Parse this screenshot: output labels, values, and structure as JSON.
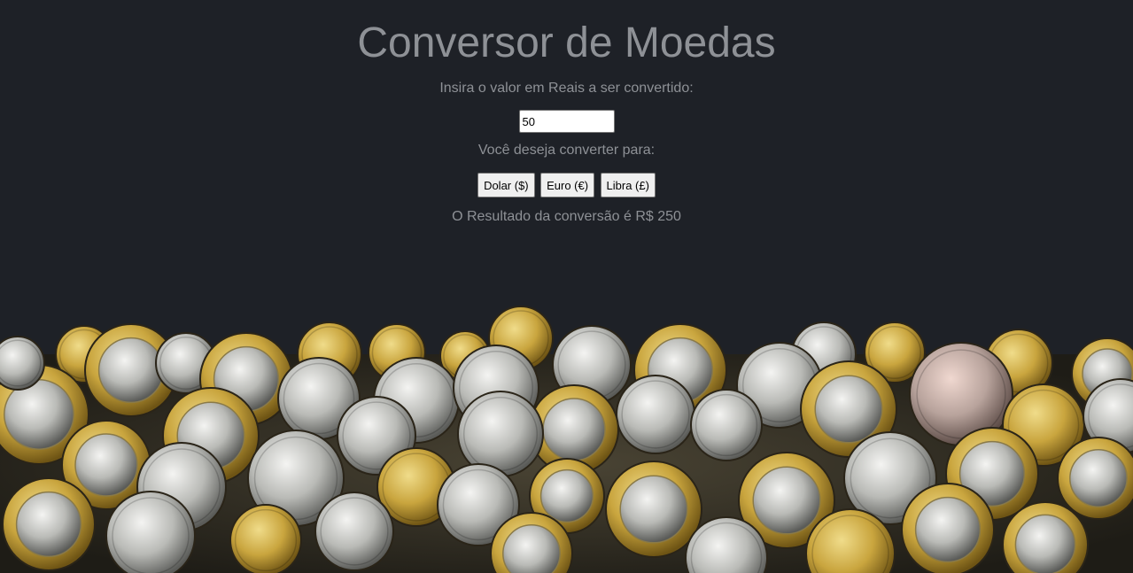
{
  "title": "Conversor de Moedas",
  "prompt_label": "Insira o valor em Reais a ser convertido:",
  "amount_value": "50",
  "convert_label": "Você deseja converter para:",
  "buttons": {
    "dollar": "Dolar ($)",
    "euro": "Euro (€)",
    "pound": "Libra (£)"
  },
  "result_text": "O Resultado da conversão é R$ 250",
  "colors": {
    "background": "#1e2127",
    "text": "#8e9196"
  },
  "image": {
    "description_icon": "coins-pile-image"
  }
}
